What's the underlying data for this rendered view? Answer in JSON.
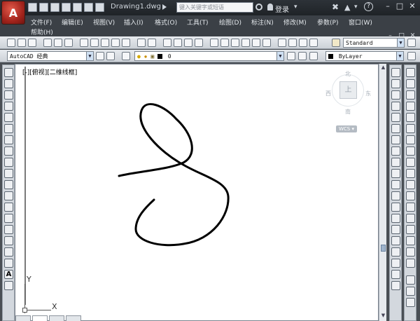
{
  "app": {
    "logo_letter": "A",
    "document_title": "Drawing1.dwg"
  },
  "titlebar": {
    "search_placeholder": "键入关键字或短语",
    "login_label": "登录",
    "help_label": "?",
    "window_buttons": [
      "–",
      "□",
      "✕"
    ],
    "mdi_buttons": [
      "–",
      "□",
      "✕"
    ]
  },
  "menu": {
    "items": [
      "文件(F)",
      "编辑(E)",
      "视图(V)",
      "插入(I)",
      "格式(O)",
      "工具(T)",
      "绘图(D)",
      "标注(N)",
      "修改(M)",
      "参数(P)",
      "窗口(W)"
    ],
    "help": "帮助(H)"
  },
  "toolbar": {
    "text_style": "Standard",
    "workspace": "AutoCAD 经典",
    "layer": "0",
    "color": "ByLayer"
  },
  "viewport": {
    "label": "[-][俯视][二维线框]"
  },
  "viewcube": {
    "north": "北",
    "south": "南",
    "west": "西",
    "east": "东",
    "top_face": "上",
    "wcs_label": "WCS ▾"
  },
  "ucs": {
    "x_label": "X",
    "y_label": "Y"
  },
  "colors": {
    "titlebar": "#23272b",
    "menubar": "#3b4046",
    "canvas": "#ffffff",
    "accent": "#b5261b"
  }
}
